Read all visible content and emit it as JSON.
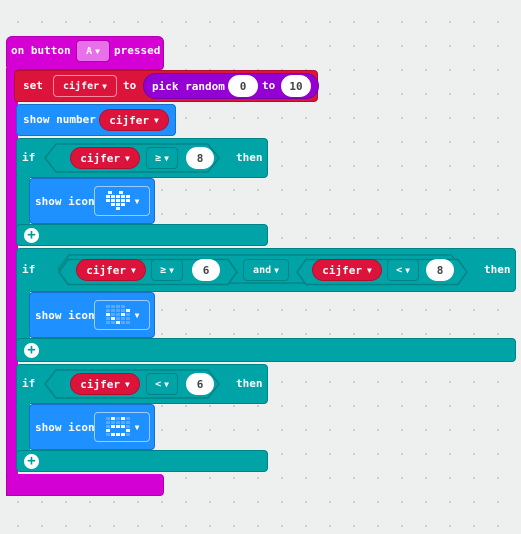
{
  "event": {
    "prefix": "on button",
    "button": "A",
    "suffix": "pressed"
  },
  "set_block": {
    "label": "set",
    "variable": "cijfer",
    "to": "to",
    "random_label": "pick random",
    "min": "0",
    "to_label": "to",
    "max": "10"
  },
  "show_number": {
    "label": "show number",
    "variable": "cijfer"
  },
  "if1": {
    "if_label": "if",
    "variable": "cijfer",
    "operator": "≥",
    "value": "8",
    "then_label": "then",
    "show_icon_label": "show icon",
    "icon": "heart-icon"
  },
  "if2": {
    "if_label": "if",
    "left_variable": "cijfer",
    "left_operator": "≥",
    "left_value": "6",
    "and_label": "and",
    "right_variable": "cijfer",
    "right_operator": "<",
    "right_value": "8",
    "then_label": "then",
    "show_icon_label": "show icon",
    "icon": "check-icon"
  },
  "if3": {
    "if_label": "if",
    "variable": "cijfer",
    "operator": "<",
    "value": "6",
    "then_label": "then",
    "show_icon_label": "show icon",
    "icon": "sad-face-icon"
  },
  "colors": {
    "event": "#d400d4",
    "variables": "#dc143c",
    "math": "#9400d3",
    "basic": "#1e90ff",
    "logic": "#00a4a6"
  }
}
